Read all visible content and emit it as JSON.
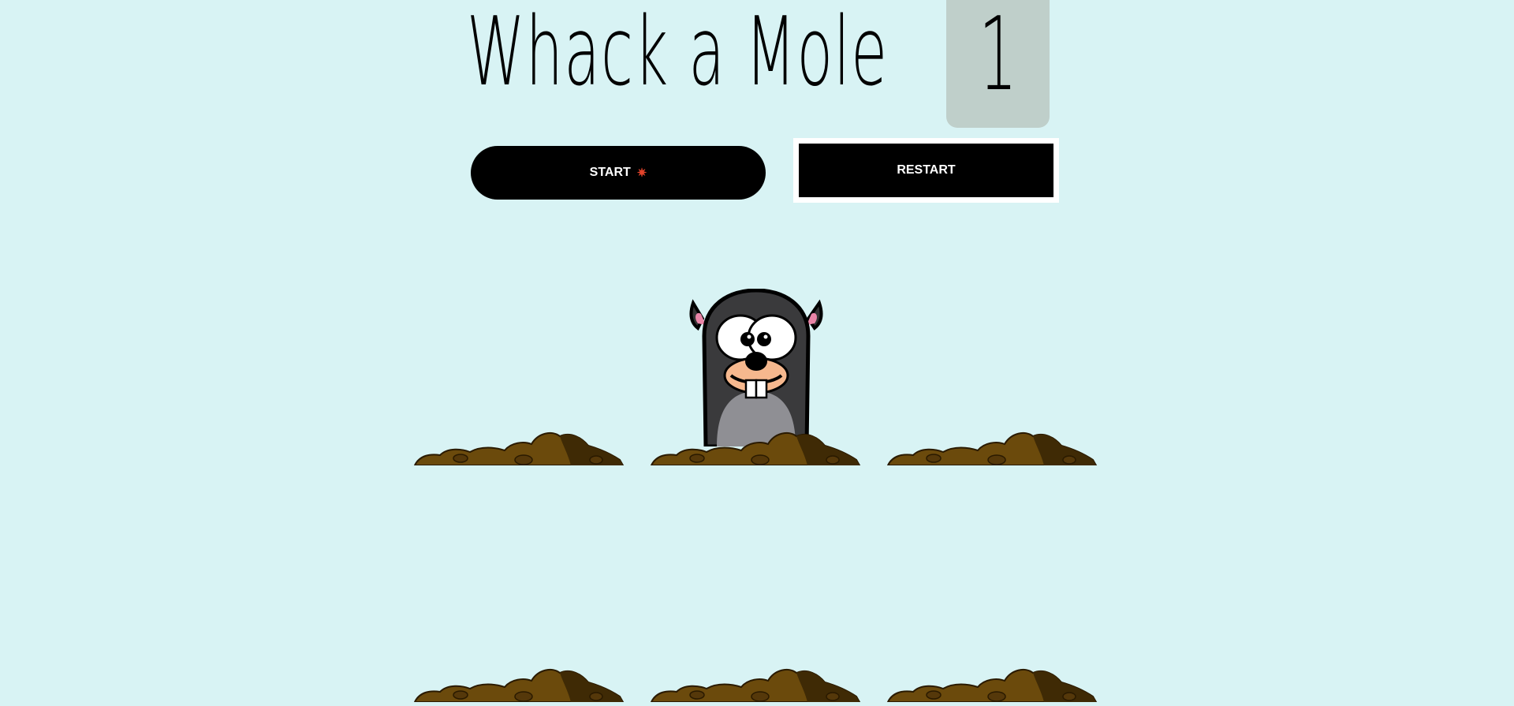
{
  "header": {
    "title": "Whack a Mole",
    "score": "1"
  },
  "controls": {
    "start_label": "START",
    "start_icon": "explosion-icon",
    "restart_label": "RESTART"
  },
  "board": {
    "holes": [
      {
        "mole_visible": false
      },
      {
        "mole_visible": true
      },
      {
        "mole_visible": false
      },
      {
        "mole_visible": false
      },
      {
        "mole_visible": false
      },
      {
        "mole_visible": false
      }
    ]
  },
  "colors": {
    "background": "#d8f3f4",
    "score_box": "#bfcfca",
    "button": "#000000",
    "dirt": "#6b4a0c"
  }
}
